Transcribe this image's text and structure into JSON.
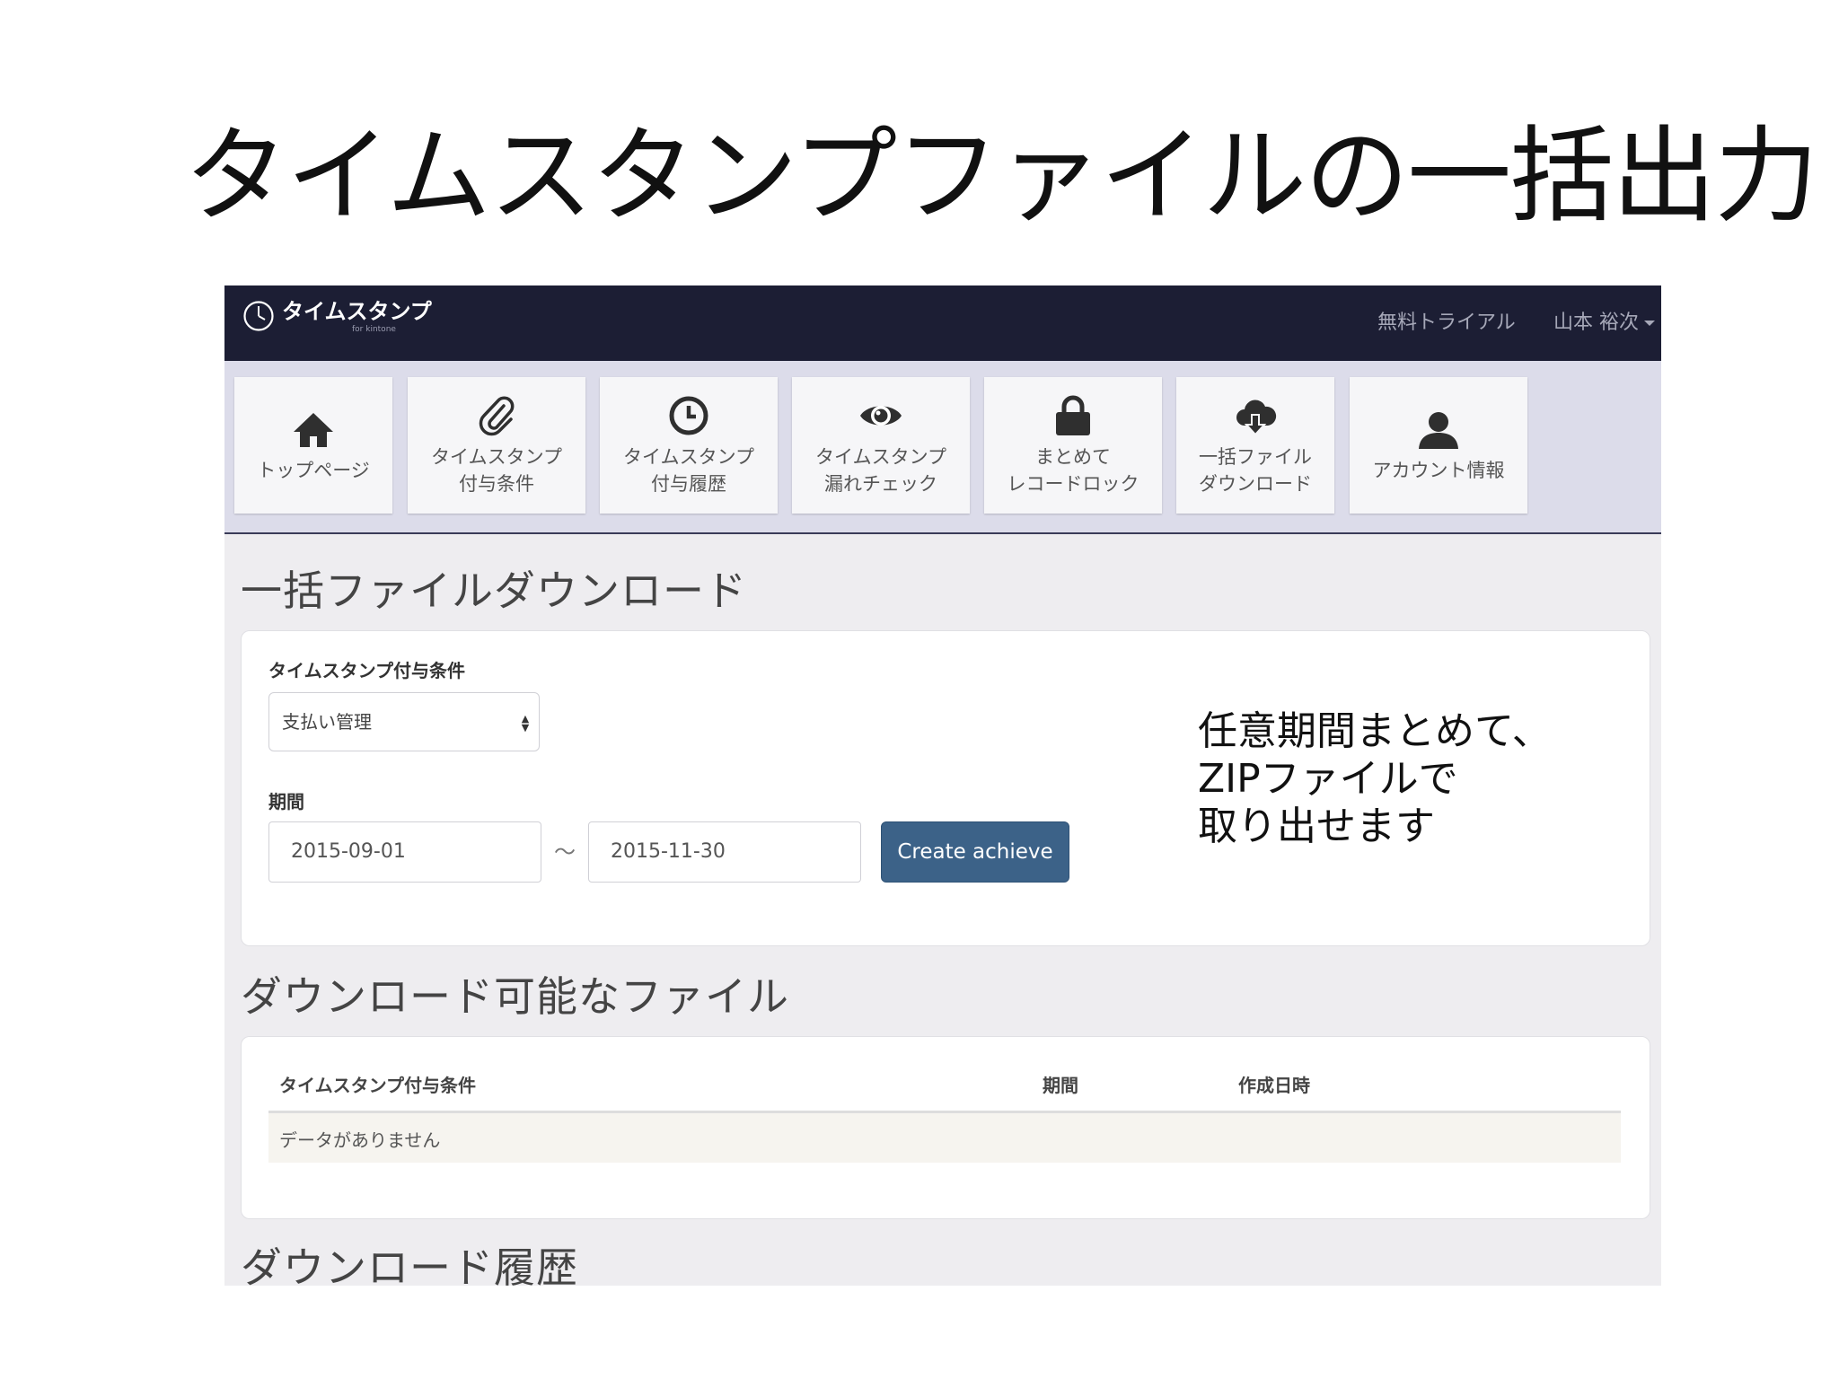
{
  "slide": {
    "title": "タイムスタンプファイルの一括出力"
  },
  "navbar": {
    "logo_text": "タイムスタンプ",
    "logo_subtext": "for kintone",
    "trial_link": "無料トライアル",
    "user_name": "山本 裕次"
  },
  "menu": [
    {
      "icon": "home-icon",
      "line1": "トップページ",
      "line2": ""
    },
    {
      "icon": "paperclip-icon",
      "line1": "タイムスタンプ",
      "line2": "付与条件"
    },
    {
      "icon": "clock-icon",
      "line1": "タイムスタンプ",
      "line2": "付与履歴"
    },
    {
      "icon": "eye-icon",
      "line1": "タイムスタンプ",
      "line2": "漏れチェック"
    },
    {
      "icon": "lock-icon",
      "line1": "まとめて",
      "line2": "レコードロック"
    },
    {
      "icon": "cloud-download-icon",
      "line1": "一括ファイル",
      "line2": "ダウンロード"
    },
    {
      "icon": "user-icon",
      "line1": "アカウント情報",
      "line2": ""
    }
  ],
  "bulk_download": {
    "heading": "一括ファイルダウンロード",
    "condition_label": "タイムスタンプ付与条件",
    "condition_value": "支払い管理",
    "period_label": "期間",
    "period_start": "2015-09-01",
    "period_separator": "〜",
    "period_end": "2015-11-30",
    "create_button": "Create achieve"
  },
  "annotation": {
    "line1": "任意期間まとめて、",
    "line2": "ZIPファイルで",
    "line3": "取り出せます"
  },
  "available_files": {
    "heading": "ダウンロード可能なファイル",
    "columns": [
      "タイムスタンプ付与条件",
      "期間",
      "作成日時"
    ],
    "empty_message": "データがありません"
  },
  "history": {
    "heading": "ダウンロード履歴"
  },
  "colors": {
    "navbar_bg": "#1c1e34",
    "menu_bg": "#dcdcea",
    "page_bg": "#eeedf0",
    "button_primary": "#3c6288",
    "empty_row_bg": "#f6f4ef"
  }
}
